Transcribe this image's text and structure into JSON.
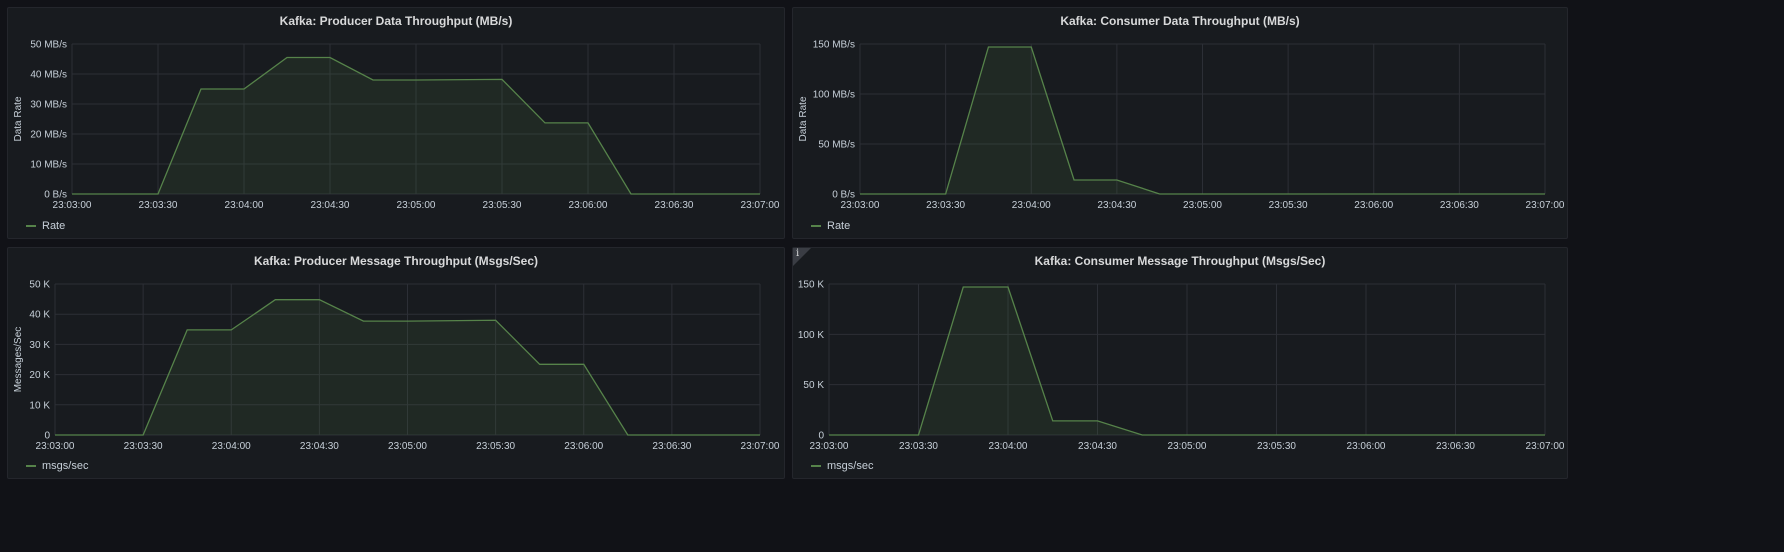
{
  "theme": {
    "background": "#111217",
    "panel": "#181b1f",
    "grid": "#2c2f36",
    "series_color": "#56834a",
    "fill_color": "#222a20"
  },
  "chart_data": [
    {
      "type": "area",
      "title": "Kafka: Producer Data Throughput (MB/s)",
      "ylabel": "Data Rate",
      "ylim": [
        0,
        50
      ],
      "yticks": [
        0,
        10,
        20,
        30,
        40,
        50
      ],
      "ytick_labels": [
        "0 B/s",
        "10 MB/s",
        "20 MB/s",
        "30 MB/s",
        "40 MB/s",
        "50 MB/s"
      ],
      "xticks": [
        "23:03:00",
        "23:03:30",
        "23:04:00",
        "23:04:30",
        "23:05:00",
        "23:05:30",
        "23:06:00",
        "23:06:30",
        "23:07:00"
      ],
      "series": [
        {
          "name": "Rate",
          "x": [
            "23:03:00",
            "23:03:30",
            "23:03:45",
            "23:04:00",
            "23:04:15",
            "23:04:30",
            "23:04:45",
            "23:05:00",
            "23:05:30",
            "23:05:45",
            "23:06:00",
            "23:06:15",
            "23:06:30",
            "23:07:00"
          ],
          "y": [
            0,
            0,
            35,
            35,
            45.5,
            45.5,
            38,
            38,
            38.2,
            23.7,
            23.7,
            0,
            0,
            0
          ]
        }
      ],
      "legend_position": "bottom-left",
      "grid": true
    },
    {
      "type": "area",
      "title": "Kafka: Consumer Data Throughput (MB/s)",
      "ylabel": "Data Rate",
      "ylim": [
        0,
        150
      ],
      "yticks": [
        0,
        50,
        100,
        150
      ],
      "ytick_labels": [
        "0 B/s",
        "50 MB/s",
        "100 MB/s",
        "150 MB/s"
      ],
      "xticks": [
        "23:03:00",
        "23:03:30",
        "23:04:00",
        "23:04:30",
        "23:05:00",
        "23:05:30",
        "23:06:00",
        "23:06:30",
        "23:07:00"
      ],
      "series": [
        {
          "name": "Rate",
          "x": [
            "23:03:00",
            "23:03:30",
            "23:03:45",
            "23:04:00",
            "23:04:15",
            "23:04:30",
            "23:04:45",
            "23:05:00",
            "23:05:30",
            "23:06:00",
            "23:06:30",
            "23:07:00"
          ],
          "y": [
            0,
            0,
            147,
            147,
            14,
            14,
            0,
            0,
            0,
            0,
            0,
            0
          ]
        }
      ],
      "legend_position": "bottom-left",
      "grid": true
    },
    {
      "type": "area",
      "title": "Kafka: Producer Message Throughput (Msgs/Sec)",
      "ylabel": "Messages/Sec",
      "ylim": [
        0,
        50000
      ],
      "yticks": [
        0,
        10000,
        20000,
        30000,
        40000,
        50000
      ],
      "ytick_labels": [
        "0",
        "10 K",
        "20 K",
        "30 K",
        "40 K",
        "50 K"
      ],
      "xticks": [
        "23:03:00",
        "23:03:30",
        "23:04:00",
        "23:04:30",
        "23:05:00",
        "23:05:30",
        "23:06:00",
        "23:06:30",
        "23:07:00"
      ],
      "series": [
        {
          "name": "msgs/sec",
          "x": [
            "23:03:00",
            "23:03:30",
            "23:03:45",
            "23:04:00",
            "23:04:15",
            "23:04:30",
            "23:04:45",
            "23:05:00",
            "23:05:30",
            "23:05:45",
            "23:06:00",
            "23:06:15",
            "23:06:30",
            "23:07:00"
          ],
          "y": [
            0,
            0,
            34800,
            34800,
            44800,
            44800,
            37700,
            37700,
            38000,
            23400,
            23400,
            0,
            0,
            0
          ]
        }
      ],
      "legend_position": "bottom-left",
      "grid": true
    },
    {
      "type": "area",
      "title": "Kafka: Consumer Message Throughput (Msgs/Sec)",
      "ylabel": "",
      "ylim": [
        0,
        150000
      ],
      "yticks": [
        0,
        50000,
        100000,
        150000
      ],
      "ytick_labels": [
        "0",
        "50 K",
        "100 K",
        "150 K"
      ],
      "xticks": [
        "23:03:00",
        "23:03:30",
        "23:04:00",
        "23:04:30",
        "23:05:00",
        "23:05:30",
        "23:06:00",
        "23:06:30",
        "23:07:00"
      ],
      "series": [
        {
          "name": "msgs/sec",
          "x": [
            "23:03:00",
            "23:03:30",
            "23:03:45",
            "23:04:00",
            "23:04:15",
            "23:04:30",
            "23:04:45",
            "23:05:00",
            "23:05:30",
            "23:06:00",
            "23:06:30",
            "23:07:00"
          ],
          "y": [
            0,
            0,
            147000,
            147000,
            14000,
            14000,
            0,
            0,
            0,
            0,
            0,
            0
          ]
        }
      ],
      "legend_position": "bottom-left",
      "grid": true,
      "info_icon": "info-icon"
    }
  ]
}
